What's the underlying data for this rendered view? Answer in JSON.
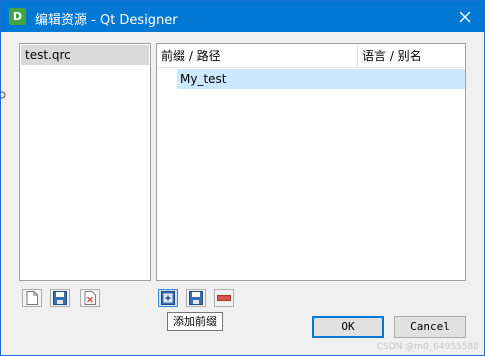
{
  "window": {
    "title": "编辑资源 - Qt Designer",
    "app_icon_letter": "D"
  },
  "left_panel": {
    "items": [
      "test.qrc"
    ]
  },
  "right_panel": {
    "headers": [
      "前缀 / 路径",
      "语言 / 别名"
    ],
    "rows": [
      "My_test"
    ]
  },
  "tooltip": "添加前缀",
  "buttons": {
    "ok": "OK",
    "cancel": "Cancel"
  },
  "watermark": "CSDN @m0_64955588",
  "colors": {
    "titlebar": "#0078d4",
    "selection": "#cce8ff",
    "remove": "#d9534f"
  }
}
